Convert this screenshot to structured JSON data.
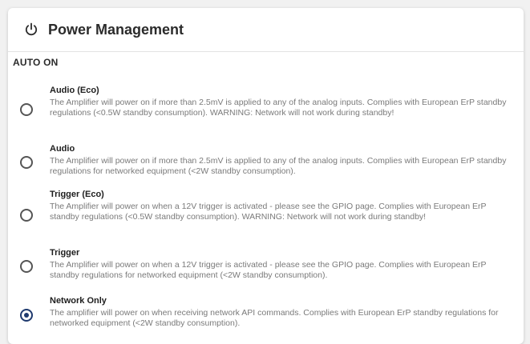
{
  "header": {
    "title": "Power Management",
    "icon": "power-icon"
  },
  "section": {
    "label": "AUTO ON"
  },
  "options": [
    {
      "title": "Audio (Eco)",
      "description": "The Amplifier will power on if more than 2.5mV is applied to any of the analog inputs. Complies with European ErP standby regulations (<0.5W standby consumption). WARNING: Network will not work during standby!",
      "selected": false
    },
    {
      "title": "Audio",
      "description": "The Amplifier will power on if more than 2.5mV is applied to any of the analog inputs. Complies with European ErP standby regulations for networked equipment (<2W standby consumption).",
      "selected": false
    },
    {
      "title": "Trigger (Eco)",
      "description": "The Amplifier will power on when a 12V trigger is activated - please see the GPIO page. Complies with European ErP standby regulations (<0.5W standby consumption). WARNING: Network will not work during standby!",
      "selected": false
    },
    {
      "title": "Trigger",
      "description": "The Amplifier will power on when a 12V trigger is activated - please see the GPIO page. Complies with European ErP standby regulations for networked equipment (<2W standby consumption).",
      "selected": false
    },
    {
      "title": "Network Only",
      "description": "The amplifier will power on when receiving network API commands. Complies with European ErP standby regulations for networked equipment (<2W standby consumption).",
      "selected": true
    }
  ],
  "colors": {
    "accent": "#1f3a6e",
    "title_text": "#2b2b2b",
    "desc_text": "#7a7a7a"
  }
}
